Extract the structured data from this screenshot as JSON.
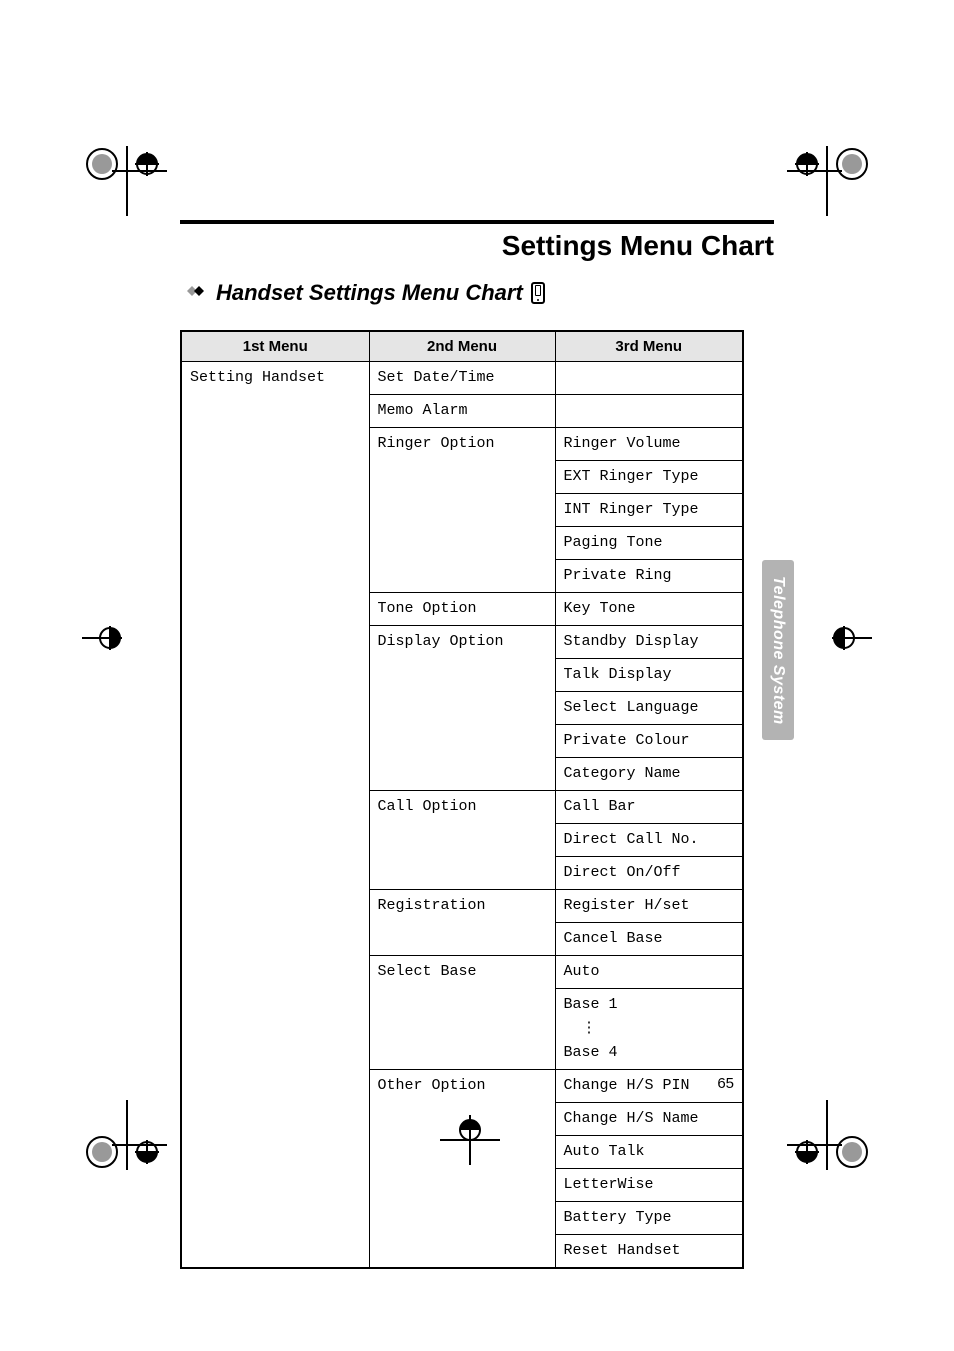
{
  "page": {
    "title": "Settings Menu Chart",
    "section_title": "Handset Settings Menu Chart",
    "page_number": "65",
    "side_tab": "Telephone System"
  },
  "chart_data": {
    "type": "table",
    "title": "Handset Settings Menu Chart",
    "headers": [
      "1st Menu",
      "2nd Menu",
      "3rd Menu"
    ],
    "rows": [
      [
        "Setting Handset",
        "Set Date/Time",
        ""
      ],
      [
        "",
        "Memo Alarm",
        ""
      ],
      [
        "",
        "Ringer Option",
        "Ringer Volume"
      ],
      [
        "",
        "",
        "EXT Ringer Type"
      ],
      [
        "",
        "",
        "INT Ringer Type"
      ],
      [
        "",
        "",
        "Paging Tone"
      ],
      [
        "",
        "",
        "Private Ring"
      ],
      [
        "",
        "Tone Option",
        "Key Tone"
      ],
      [
        "",
        "Display Option",
        "Standby Display"
      ],
      [
        "",
        "",
        "Talk Display"
      ],
      [
        "",
        "",
        "Select Language"
      ],
      [
        "",
        "",
        "Private Colour"
      ],
      [
        "",
        "",
        "Category Name"
      ],
      [
        "",
        "Call Option",
        "Call Bar"
      ],
      [
        "",
        "",
        "Direct Call No."
      ],
      [
        "",
        "",
        "Direct On/Off"
      ],
      [
        "",
        "Registration",
        "Register H/set"
      ],
      [
        "",
        "",
        "Cancel Base"
      ],
      [
        "",
        "Select Base",
        "Auto"
      ],
      [
        "",
        "",
        "Base 1\n  ⋮\nBase 4"
      ],
      [
        "",
        "Other Option",
        "Change H/S PIN"
      ],
      [
        "",
        "",
        "Change H/S Name"
      ],
      [
        "",
        "",
        "Auto Talk"
      ],
      [
        "",
        "",
        "LetterWise"
      ],
      [
        "",
        "",
        "Battery Type"
      ],
      [
        "",
        "",
        "Reset Handset"
      ]
    ]
  }
}
